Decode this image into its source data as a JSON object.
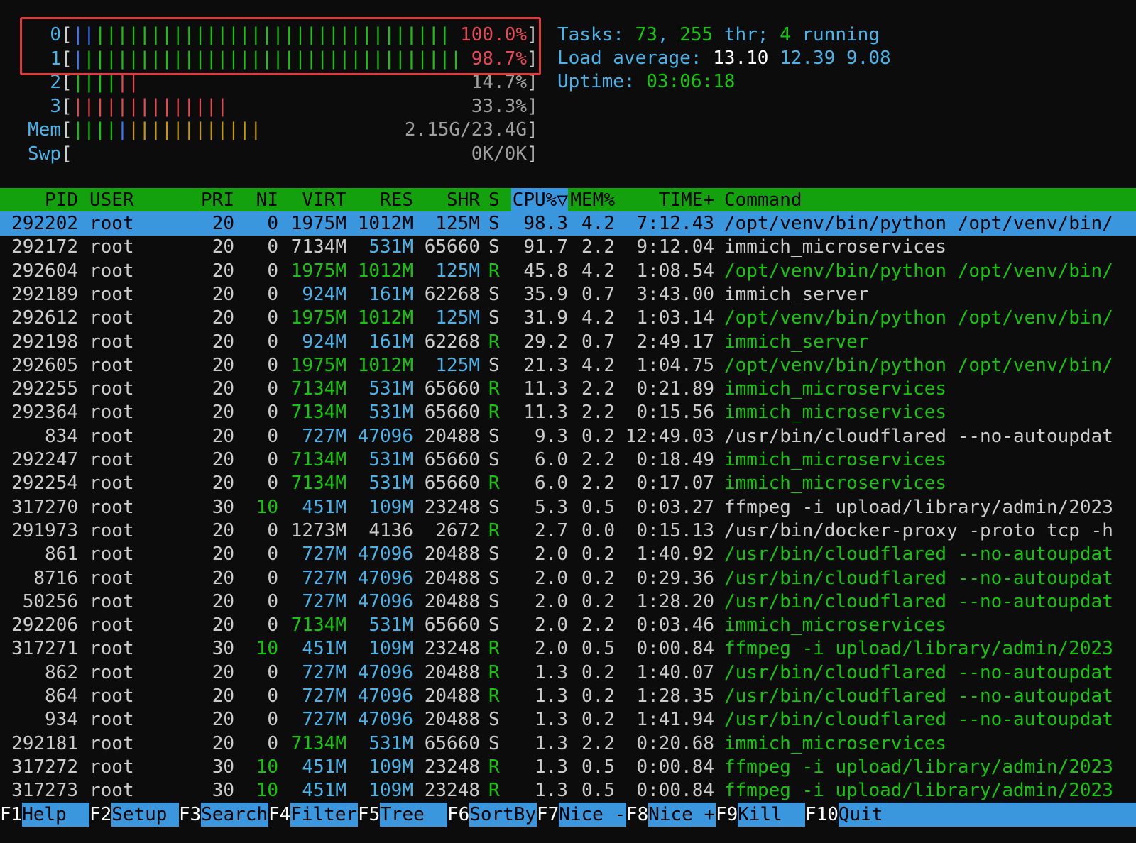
{
  "meters": [
    {
      "label": "0",
      "bars": [
        {
          "c": "bl",
          "t": "||"
        },
        {
          "c": "gr",
          "t": "||||||||||||||||||||||||||||||||"
        }
      ],
      "value": "100.0%",
      "value_color": "rd"
    },
    {
      "label": "1",
      "bars": [
        {
          "c": "bl",
          "t": "|"
        },
        {
          "c": "gr",
          "t": "||||||||||||||||||||||||||||||||||"
        }
      ],
      "value": "98.7%",
      "value_color": "rd"
    },
    {
      "label": "2",
      "bars": [
        {
          "c": "gr",
          "t": "||||"
        },
        {
          "c": "rd",
          "t": "||"
        }
      ],
      "value": "14.7%",
      "value_color": "dim"
    },
    {
      "label": "3",
      "bars": [
        {
          "c": "rd",
          "t": "||||||||||||||"
        }
      ],
      "value": "33.3%",
      "value_color": "dim"
    },
    {
      "label": "Mem",
      "bars": [
        {
          "c": "gr",
          "t": "||||"
        },
        {
          "c": "bl",
          "t": "|"
        },
        {
          "c": "yl",
          "t": "||||||||||||"
        }
      ],
      "value": "2.15G/23.4G",
      "value_color": "dim"
    },
    {
      "label": "Swp",
      "bars": [],
      "value": "0K/0K",
      "value_color": "dim"
    }
  ],
  "summary": {
    "tasks_label": "Tasks: ",
    "tasks": "73",
    "thr_sep": ", ",
    "thr": "255",
    "thr_label": " thr; ",
    "running": "4",
    "running_label": " running",
    "load_label": "Load average: ",
    "load1": "13.10",
    "load5": "12.39",
    "load15": "9.08",
    "uptime_label": "Uptime: ",
    "uptime": "03:06:18"
  },
  "columns": [
    "PID",
    "USER",
    "PRI",
    "NI",
    "VIRT",
    "RES",
    "SHR",
    "S",
    "CPU%▽",
    "MEM%",
    "TIME+",
    "Command"
  ],
  "processes": [
    {
      "pid": "292202",
      "user": "root",
      "pri": "20",
      "ni": "0",
      "virt": "1975M",
      "res": "1012M",
      "shr": "125M",
      "s": "S",
      "cpu": "98.3",
      "mem": "4.2",
      "time": "7:12.43",
      "cmd": "/opt/venv/bin/python /opt/venv/bin/",
      "thread": false,
      "selected": true
    },
    {
      "pid": "292172",
      "user": "root",
      "pri": "20",
      "ni": "0",
      "virt": "7134M",
      "res": "531M",
      "shr": "65660",
      "s": "S",
      "cpu": "91.7",
      "mem": "2.2",
      "time": "9:12.04",
      "cmd": "immich_microservices",
      "thread": false
    },
    {
      "pid": "292604",
      "user": "root",
      "pri": "20",
      "ni": "0",
      "virt": "1975M",
      "res": "1012M",
      "shr": "125M",
      "s": "R",
      "cpu": "45.8",
      "mem": "4.2",
      "time": "1:08.54",
      "cmd": "/opt/venv/bin/python /opt/venv/bin/",
      "thread": true
    },
    {
      "pid": "292189",
      "user": "root",
      "pri": "20",
      "ni": "0",
      "virt": "924M",
      "res": "161M",
      "shr": "62268",
      "s": "S",
      "cpu": "35.9",
      "mem": "0.7",
      "time": "3:43.00",
      "cmd": "immich_server",
      "thread": false
    },
    {
      "pid": "292612",
      "user": "root",
      "pri": "20",
      "ni": "0",
      "virt": "1975M",
      "res": "1012M",
      "shr": "125M",
      "s": "S",
      "cpu": "31.9",
      "mem": "4.2",
      "time": "1:03.14",
      "cmd": "/opt/venv/bin/python /opt/venv/bin/",
      "thread": true
    },
    {
      "pid": "292198",
      "user": "root",
      "pri": "20",
      "ni": "0",
      "virt": "924M",
      "res": "161M",
      "shr": "62268",
      "s": "R",
      "cpu": "29.2",
      "mem": "0.7",
      "time": "2:49.17",
      "cmd": "immich_server",
      "thread": true
    },
    {
      "pid": "292605",
      "user": "root",
      "pri": "20",
      "ni": "0",
      "virt": "1975M",
      "res": "1012M",
      "shr": "125M",
      "s": "S",
      "cpu": "21.3",
      "mem": "4.2",
      "time": "1:04.75",
      "cmd": "/opt/venv/bin/python /opt/venv/bin/",
      "thread": true
    },
    {
      "pid": "292255",
      "user": "root",
      "pri": "20",
      "ni": "0",
      "virt": "7134M",
      "res": "531M",
      "shr": "65660",
      "s": "R",
      "cpu": "11.3",
      "mem": "2.2",
      "time": "0:21.89",
      "cmd": "immich_microservices",
      "thread": true
    },
    {
      "pid": "292364",
      "user": "root",
      "pri": "20",
      "ni": "0",
      "virt": "7134M",
      "res": "531M",
      "shr": "65660",
      "s": "R",
      "cpu": "11.3",
      "mem": "2.2",
      "time": "0:15.56",
      "cmd": "immich_microservices",
      "thread": true
    },
    {
      "pid": "834",
      "user": "root",
      "pri": "20",
      "ni": "0",
      "virt": "727M",
      "res": "47096",
      "shr": "20488",
      "s": "S",
      "cpu": "9.3",
      "mem": "0.2",
      "time": "12:49.03",
      "cmd": "/usr/bin/cloudflared --no-autoupdat",
      "thread": false
    },
    {
      "pid": "292247",
      "user": "root",
      "pri": "20",
      "ni": "0",
      "virt": "7134M",
      "res": "531M",
      "shr": "65660",
      "s": "S",
      "cpu": "6.0",
      "mem": "2.2",
      "time": "0:18.49",
      "cmd": "immich_microservices",
      "thread": true
    },
    {
      "pid": "292254",
      "user": "root",
      "pri": "20",
      "ni": "0",
      "virt": "7134M",
      "res": "531M",
      "shr": "65660",
      "s": "R",
      "cpu": "6.0",
      "mem": "2.2",
      "time": "0:17.07",
      "cmd": "immich_microservices",
      "thread": true
    },
    {
      "pid": "317270",
      "user": "root",
      "pri": "30",
      "ni": "10",
      "virt": "451M",
      "res": "109M",
      "shr": "23248",
      "s": "S",
      "cpu": "5.3",
      "mem": "0.5",
      "time": "0:03.27",
      "cmd": "ffmpeg -i upload/library/admin/2023",
      "thread": false
    },
    {
      "pid": "291973",
      "user": "root",
      "pri": "20",
      "ni": "0",
      "virt": "1273M",
      "res": "4136",
      "shr": "2672",
      "s": "R",
      "cpu": "2.7",
      "mem": "0.0",
      "time": "0:15.13",
      "cmd": "/usr/bin/docker-proxy -proto tcp -h",
      "thread": false
    },
    {
      "pid": "861",
      "user": "root",
      "pri": "20",
      "ni": "0",
      "virt": "727M",
      "res": "47096",
      "shr": "20488",
      "s": "S",
      "cpu": "2.0",
      "mem": "0.2",
      "time": "1:40.92",
      "cmd": "/usr/bin/cloudflared --no-autoupdat",
      "thread": true
    },
    {
      "pid": "8716",
      "user": "root",
      "pri": "20",
      "ni": "0",
      "virt": "727M",
      "res": "47096",
      "shr": "20488",
      "s": "S",
      "cpu": "2.0",
      "mem": "0.2",
      "time": "0:29.36",
      "cmd": "/usr/bin/cloudflared --no-autoupdat",
      "thread": true
    },
    {
      "pid": "50256",
      "user": "root",
      "pri": "20",
      "ni": "0",
      "virt": "727M",
      "res": "47096",
      "shr": "20488",
      "s": "S",
      "cpu": "2.0",
      "mem": "0.2",
      "time": "1:28.20",
      "cmd": "/usr/bin/cloudflared --no-autoupdat",
      "thread": true
    },
    {
      "pid": "292206",
      "user": "root",
      "pri": "20",
      "ni": "0",
      "virt": "7134M",
      "res": "531M",
      "shr": "65660",
      "s": "S",
      "cpu": "2.0",
      "mem": "2.2",
      "time": "0:03.46",
      "cmd": "immich_microservices",
      "thread": true
    },
    {
      "pid": "317271",
      "user": "root",
      "pri": "30",
      "ni": "10",
      "virt": "451M",
      "res": "109M",
      "shr": "23248",
      "s": "R",
      "cpu": "2.0",
      "mem": "0.5",
      "time": "0:00.84",
      "cmd": "ffmpeg -i upload/library/admin/2023",
      "thread": true
    },
    {
      "pid": "862",
      "user": "root",
      "pri": "20",
      "ni": "0",
      "virt": "727M",
      "res": "47096",
      "shr": "20488",
      "s": "R",
      "cpu": "1.3",
      "mem": "0.2",
      "time": "1:40.07",
      "cmd": "/usr/bin/cloudflared --no-autoupdat",
      "thread": true
    },
    {
      "pid": "864",
      "user": "root",
      "pri": "20",
      "ni": "0",
      "virt": "727M",
      "res": "47096",
      "shr": "20488",
      "s": "R",
      "cpu": "1.3",
      "mem": "0.2",
      "time": "1:28.35",
      "cmd": "/usr/bin/cloudflared --no-autoupdat",
      "thread": true
    },
    {
      "pid": "934",
      "user": "root",
      "pri": "20",
      "ni": "0",
      "virt": "727M",
      "res": "47096",
      "shr": "20488",
      "s": "S",
      "cpu": "1.3",
      "mem": "0.2",
      "time": "1:41.94",
      "cmd": "/usr/bin/cloudflared --no-autoupdat",
      "thread": true
    },
    {
      "pid": "292181",
      "user": "root",
      "pri": "20",
      "ni": "0",
      "virt": "7134M",
      "res": "531M",
      "shr": "65660",
      "s": "S",
      "cpu": "1.3",
      "mem": "2.2",
      "time": "0:20.68",
      "cmd": "immich_microservices",
      "thread": true
    },
    {
      "pid": "317272",
      "user": "root",
      "pri": "30",
      "ni": "10",
      "virt": "451M",
      "res": "109M",
      "shr": "23248",
      "s": "R",
      "cpu": "1.3",
      "mem": "0.5",
      "time": "0:00.84",
      "cmd": "ffmpeg -i upload/library/admin/2023",
      "thread": true
    },
    {
      "pid": "317273",
      "user": "root",
      "pri": "30",
      "ni": "10",
      "virt": "451M",
      "res": "109M",
      "shr": "23248",
      "s": "R",
      "cpu": "1.3",
      "mem": "0.5",
      "time": "0:00.84",
      "cmd": "ffmpeg -i upload/library/admin/2023",
      "thread": true
    }
  ],
  "function_keys": [
    {
      "key": "F1",
      "label": "Help"
    },
    {
      "key": "F2",
      "label": "Setup"
    },
    {
      "key": "F3",
      "label": "Search"
    },
    {
      "key": "F4",
      "label": "Filter"
    },
    {
      "key": "F5",
      "label": "Tree"
    },
    {
      "key": "F6",
      "label": "SortBy"
    },
    {
      "key": "F7",
      "label": "Nice -"
    },
    {
      "key": "F8",
      "label": "Nice +"
    },
    {
      "key": "F9",
      "label": "Kill"
    },
    {
      "key": "F10",
      "label": "Quit"
    }
  ],
  "colors": {
    "background": "#0c0c0c",
    "header_bg": "#13a10e",
    "selected_bg": "#3a96dd",
    "highlight_box": "#e0393e",
    "thread_text": "#16c60c",
    "label_cyan": "#4bb3e8"
  }
}
